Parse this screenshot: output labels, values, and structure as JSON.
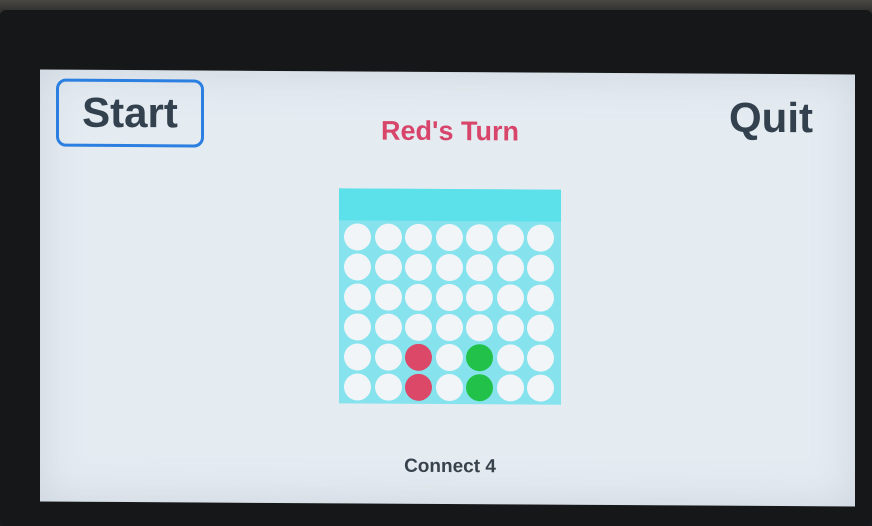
{
  "header": {
    "start_label": "Start",
    "quit_label": "Quit",
    "turn_text": "Red's Turn",
    "turn_color": "#d8456a"
  },
  "board": {
    "rows": 6,
    "cols": 7,
    "colors": {
      "empty": "#f1f5f8",
      "red": "#dc4868",
      "green": "#22c24a",
      "board": "#86e3ee",
      "drop_zone": "#5ce0ea"
    },
    "grid": [
      [
        ".",
        ".",
        ".",
        ".",
        ".",
        ".",
        "."
      ],
      [
        ".",
        ".",
        ".",
        ".",
        ".",
        ".",
        "."
      ],
      [
        ".",
        ".",
        ".",
        ".",
        ".",
        ".",
        "."
      ],
      [
        ".",
        ".",
        ".",
        ".",
        ".",
        ".",
        "."
      ],
      [
        ".",
        ".",
        "R",
        ".",
        "G",
        ".",
        "."
      ],
      [
        ".",
        ".",
        "R",
        ".",
        "G",
        ".",
        "."
      ]
    ]
  },
  "footer": {
    "game_title": "Connect 4"
  }
}
